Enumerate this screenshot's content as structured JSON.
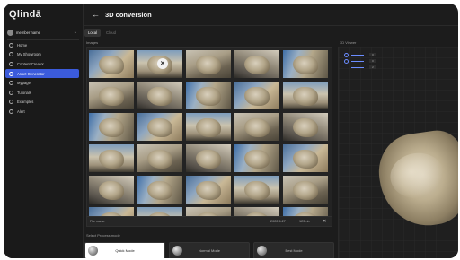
{
  "brand": {
    "logo": "Qlindā"
  },
  "user": {
    "name": "member name"
  },
  "sidebar": {
    "items": [
      {
        "label": "Home",
        "icon": "home-icon",
        "active": false
      },
      {
        "label": "My Showroom",
        "icon": "showroom-icon",
        "active": false
      },
      {
        "label": "Content Creator",
        "icon": "content-icon",
        "active": false
      },
      {
        "label": "Asset Generator",
        "icon": "asset-icon",
        "active": true
      },
      {
        "label": "Mypage",
        "icon": "user-icon",
        "active": false
      },
      {
        "label": "Tutorials",
        "icon": "tutorial-icon",
        "active": false
      },
      {
        "label": "Examples",
        "icon": "examples-icon",
        "active": false
      },
      {
        "label": "Alert",
        "icon": "alert-icon",
        "active": false
      }
    ]
  },
  "header": {
    "back_icon": "←",
    "title": "3D conversion"
  },
  "tabs": [
    {
      "label": "Local",
      "active": true
    },
    {
      "label": "Cloud",
      "active": false
    }
  ],
  "images": {
    "label": "Images",
    "count": 30
  },
  "file": {
    "name": "File name",
    "date": "2022.6.27",
    "size": "123mb"
  },
  "viewer": {
    "label": "3D Viewer",
    "values": [
      "0",
      "0",
      "2"
    ]
  },
  "process": {
    "label": "Select Process mode",
    "modes": [
      {
        "label": "Quick Mode",
        "active": true
      },
      {
        "label": "Normal Mode",
        "active": false
      },
      {
        "label": "Best Mode",
        "active": false
      }
    ]
  },
  "colors": {
    "accent": "#3b5bdb",
    "background": "#1c1c1c"
  }
}
